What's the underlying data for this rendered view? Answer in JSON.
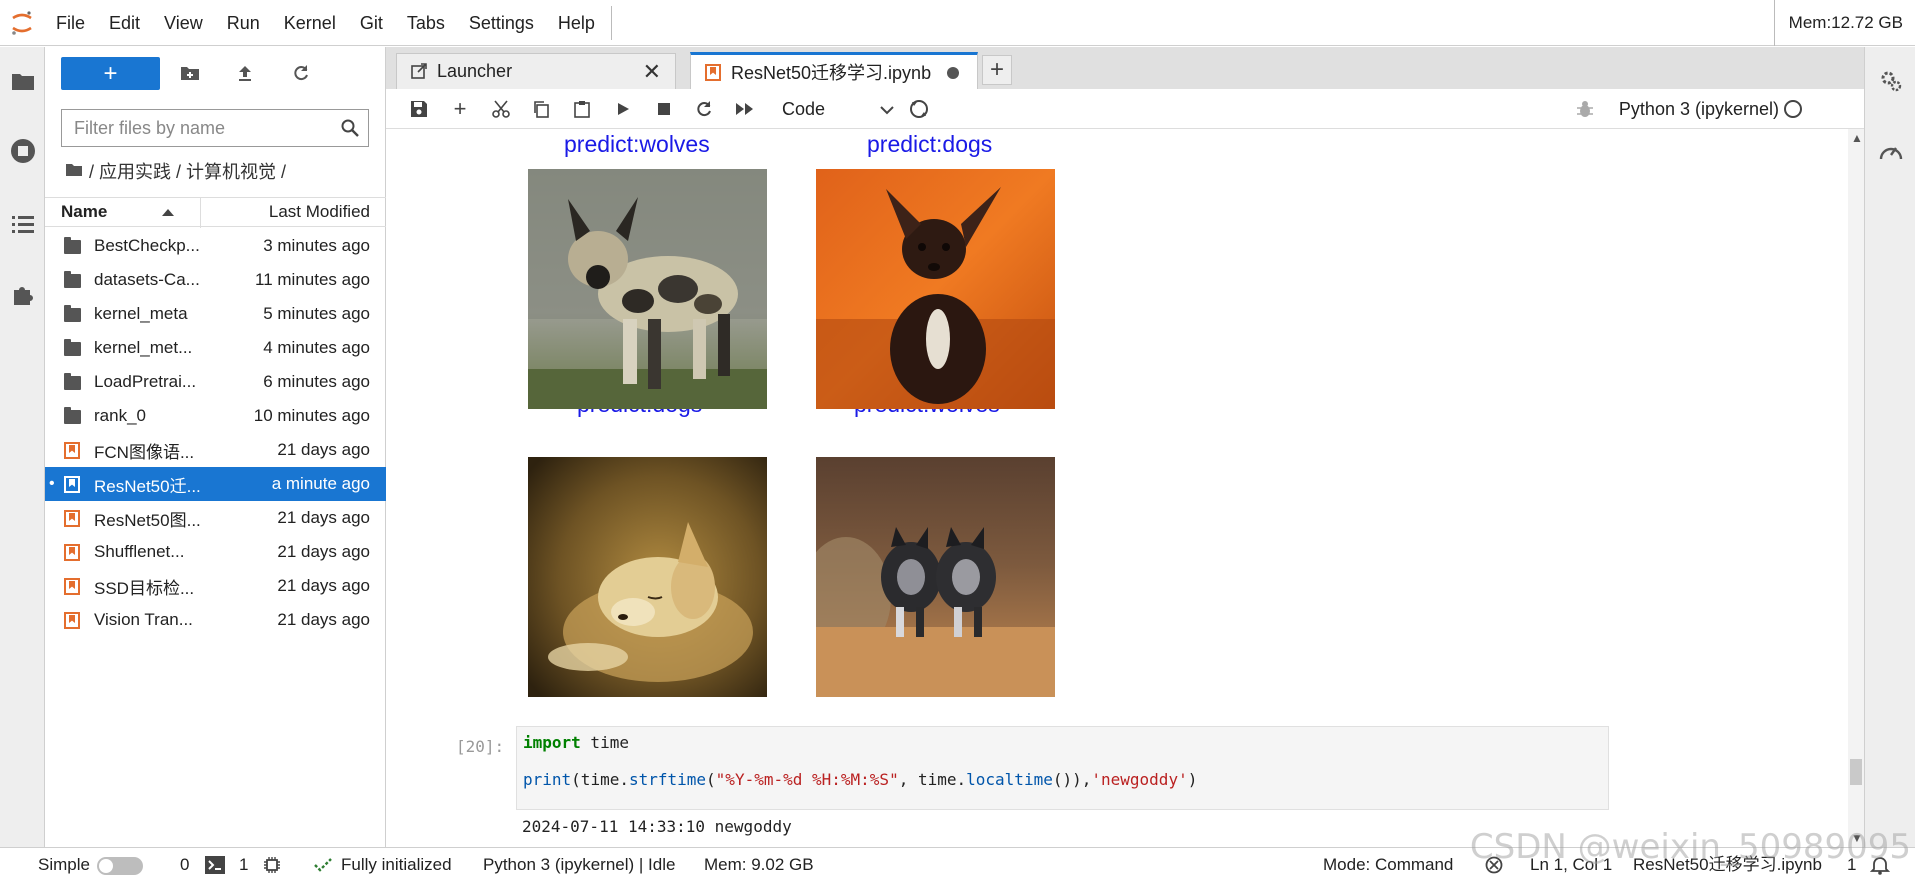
{
  "menubar": {
    "items": [
      "File",
      "Edit",
      "View",
      "Run",
      "Kernel",
      "Git",
      "Tabs",
      "Settings",
      "Help"
    ],
    "memory": "Mem:12.72 GB"
  },
  "filebrowser": {
    "new_label": "+",
    "filter_placeholder": "Filter files by name",
    "breadcrumb": "/ 应用实践 / 计算机视觉 /",
    "col_name": "Name",
    "col_modified": "Last Modified",
    "files": [
      {
        "name": "BestCheckp...",
        "modified": "3 minutes ago",
        "type": "folder"
      },
      {
        "name": "datasets-Ca...",
        "modified": "11 minutes ago",
        "type": "folder"
      },
      {
        "name": "kernel_meta",
        "modified": "5 minutes ago",
        "type": "folder"
      },
      {
        "name": "kernel_met...",
        "modified": "4 minutes ago",
        "type": "folder"
      },
      {
        "name": "LoadPretrai...",
        "modified": "6 minutes ago",
        "type": "folder"
      },
      {
        "name": "rank_0",
        "modified": "10 minutes ago",
        "type": "folder"
      },
      {
        "name": "FCN图像语...",
        "modified": "21 days ago",
        "type": "notebook"
      },
      {
        "name": "ResNet50迁...",
        "modified": "a minute ago",
        "type": "notebook",
        "selected": true
      },
      {
        "name": "ResNet50图...",
        "modified": "21 days ago",
        "type": "notebook"
      },
      {
        "name": "Shufflenet...",
        "modified": "21 days ago",
        "type": "notebook"
      },
      {
        "name": "SSD目标检...",
        "modified": "21 days ago",
        "type": "notebook"
      },
      {
        "name": "Vision Tran...",
        "modified": "21 days ago",
        "type": "notebook"
      }
    ]
  },
  "tabs": [
    {
      "label": "Launcher",
      "close": "✕"
    },
    {
      "label": "ResNet50迁移学习.ipynb",
      "active": true
    }
  ],
  "add_tab": "+",
  "notebook_toolbar": {
    "cell_type": "Code",
    "kernel": "Python 3 (ipykernel)"
  },
  "predictions": [
    {
      "title": "predict:wolves"
    },
    {
      "title": "predict:dogs"
    },
    {
      "title": "predict:dogs"
    },
    {
      "title": "predict:wolves"
    }
  ],
  "code_cell": {
    "prompt": "[20]:",
    "line1_kw": "import",
    "line1_rest": " time",
    "line2_a": "print",
    "line2_b": "(time.",
    "line2_fn": "strftime",
    "line2_c": "(",
    "line2_str": "\"%Y-%m-%d %H:%M:%S\"",
    "line2_d": ", time.",
    "line2_fn2": "localtime",
    "line2_e": "()),",
    "line2_str2": "'newgoddy'",
    "line2_f": ")",
    "output": "2024-07-11 14:33:10 newgoddy"
  },
  "statusbar": {
    "simple": "Simple",
    "terminals": "0",
    "kernels": "1",
    "initialized": "Fully initialized",
    "kernel_status": "Python 3 (ipykernel) | Idle",
    "memory": "Mem: 9.02 GB",
    "mode": "Mode: Command",
    "cursor": "Ln 1, Col 1",
    "filename": "ResNet50迁移学习.ipynb",
    "notifications": "1"
  },
  "watermark": "CSDN @weixin_50989095",
  "colors": {
    "accent": "#1976d2",
    "prediction_text": "#1a1ae6",
    "notebook_icon": "#e46e2e"
  }
}
